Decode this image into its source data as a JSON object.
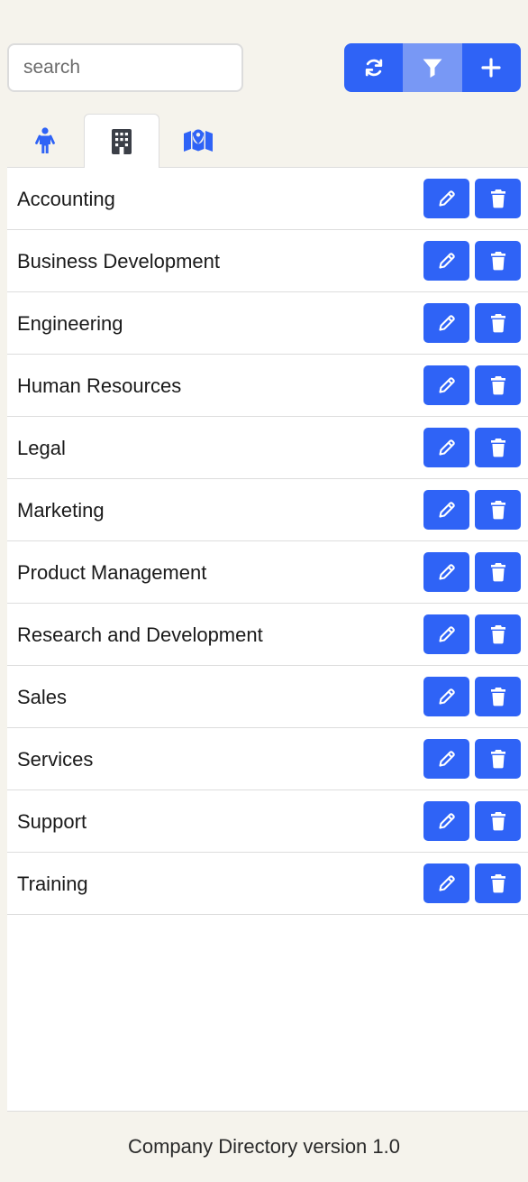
{
  "search": {
    "placeholder": "search",
    "value": ""
  },
  "toolbar": {
    "buttons": [
      {
        "icon": "refresh-icon",
        "active": false
      },
      {
        "icon": "filter-icon",
        "active": true
      },
      {
        "icon": "plus-icon",
        "active": false
      }
    ]
  },
  "tabs": [
    {
      "icon": "person-icon",
      "active": false
    },
    {
      "icon": "building-icon",
      "active": true
    },
    {
      "icon": "map-icon",
      "active": false
    }
  ],
  "departments": [
    {
      "name": "Accounting"
    },
    {
      "name": "Business Development"
    },
    {
      "name": "Engineering"
    },
    {
      "name": "Human Resources"
    },
    {
      "name": "Legal"
    },
    {
      "name": "Marketing"
    },
    {
      "name": "Product Management"
    },
    {
      "name": "Research and Development"
    },
    {
      "name": "Sales"
    },
    {
      "name": "Services"
    },
    {
      "name": "Support"
    },
    {
      "name": "Training"
    }
  ],
  "footer": {
    "text": "Company Directory version 1.0"
  },
  "colors": {
    "primary": "#2f63f6",
    "primary_active": "#7898f5",
    "background": "#f5f3ec",
    "panel": "#ffffff",
    "divider": "#dddddd"
  }
}
